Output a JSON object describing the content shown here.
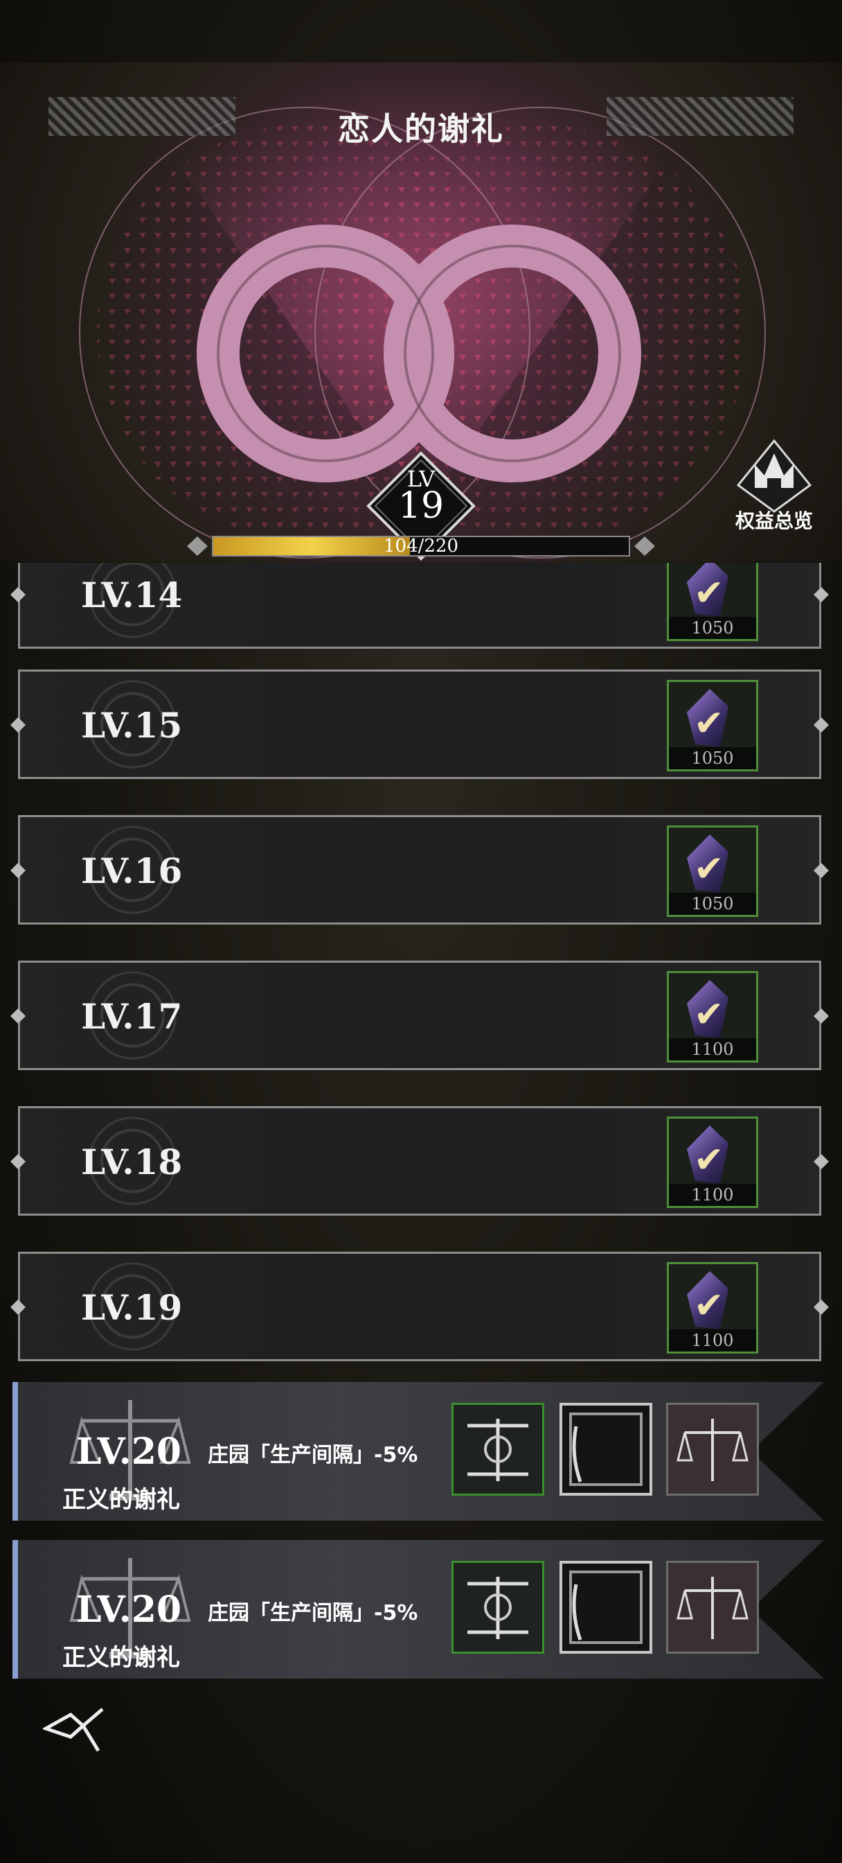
{
  "header": {
    "title": "恋人的谢礼",
    "level_label": "LV",
    "level_value": "19",
    "progress_text": "104/220",
    "progress_fraction": 0.4727,
    "rights_label": "权益总览"
  },
  "rows": [
    {
      "level": "LV.14",
      "reward_count": "1050"
    },
    {
      "level": "LV.15",
      "reward_count": "1050"
    },
    {
      "level": "LV.16",
      "reward_count": "1050"
    },
    {
      "level": "LV.17",
      "reward_count": "1100"
    },
    {
      "level": "LV.18",
      "reward_count": "1100"
    },
    {
      "level": "LV.19",
      "reward_count": "1100"
    }
  ],
  "premium_rows": [
    {
      "level": "LV.20",
      "name": "正义的谢礼",
      "desc": "庄园「生产间隔」-5%"
    },
    {
      "level": "LV.20",
      "name": "正义的谢礼",
      "desc": "庄园「生产间隔」-5%"
    }
  ],
  "colors": {
    "accent_gold": "#f3d24a",
    "claimed_border": "#4f8f3a",
    "ring": "#c58fb0"
  },
  "icons": {
    "reward": "crystal-gem-icon",
    "claimed": "check-icon",
    "rights": "crown-icon",
    "back": "back-logo-icon"
  }
}
